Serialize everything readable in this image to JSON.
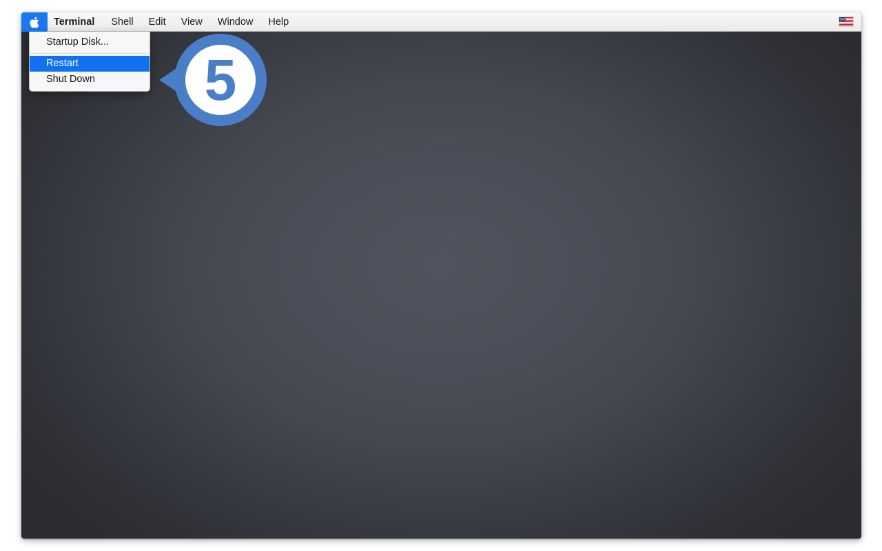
{
  "screen": {
    "wallpaper_name": "dark-slate-gradient",
    "background_color": "#4b4e58",
    "vignette_color": "#2b2c31"
  },
  "menubar": {
    "background_color": "#f2f2f2",
    "apple_icon": "apple-logo-icon",
    "apple_highlight_color": "#1878f0",
    "items": [
      {
        "label": "Terminal",
        "bold": true
      },
      {
        "label": "Shell",
        "bold": false
      },
      {
        "label": "Edit",
        "bold": false
      },
      {
        "label": "View",
        "bold": false
      },
      {
        "label": "Window",
        "bold": false
      },
      {
        "label": "Help",
        "bold": false
      }
    ],
    "status_items": [
      {
        "icon": "us-flag-icon",
        "label": "U.S. input source"
      }
    ]
  },
  "apple_menu": {
    "highlight_color": "#1171ef",
    "items": [
      {
        "label": "Startup Disk...",
        "selected": false,
        "separator_after": true
      },
      {
        "label": "Restart",
        "selected": true,
        "separator_after": false
      },
      {
        "label": "Shut Down",
        "selected": false,
        "separator_after": false
      }
    ]
  },
  "callout": {
    "number": "5",
    "ring_color": "#4a7fc8",
    "fill_color": "#ffffff",
    "points_to": "Restart"
  }
}
